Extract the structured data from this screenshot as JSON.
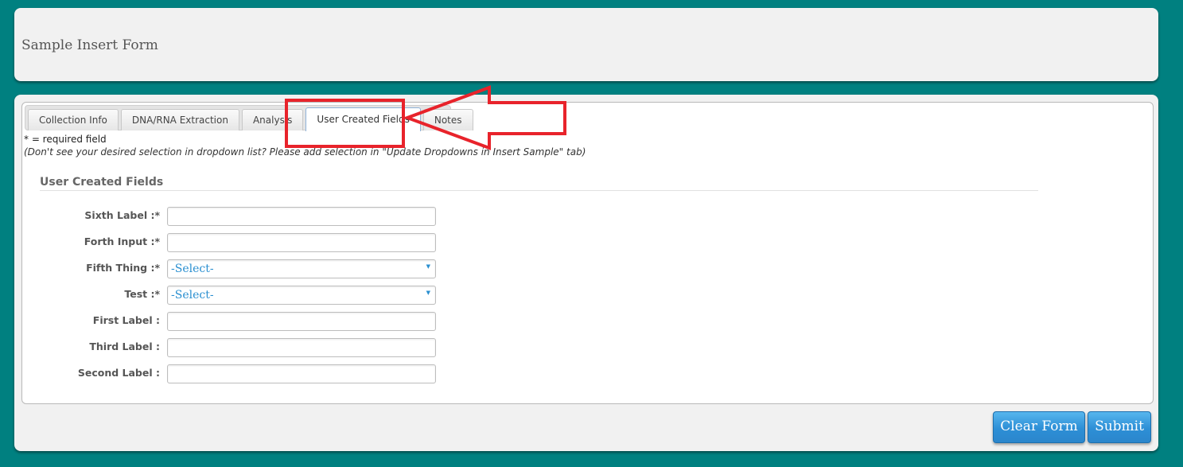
{
  "header": {
    "title": "Sample Insert Form"
  },
  "tabs": [
    {
      "label": "Collection Info",
      "active": false
    },
    {
      "label": "DNA/RNA Extraction",
      "active": false
    },
    {
      "label": "Analysis",
      "active": false
    },
    {
      "label": "User Created Fields",
      "active": true
    },
    {
      "label": "Notes",
      "active": false
    }
  ],
  "notes": {
    "required": "* = required field",
    "dropdown": "(Don't see your desired selection in dropdown list? Please add selection in \"Update Dropdowns in Insert Sample\" tab)"
  },
  "section": {
    "title": "User Created Fields"
  },
  "fields": [
    {
      "label": "Sixth Label :*",
      "type": "text",
      "value": ""
    },
    {
      "label": "Forth Input :*",
      "type": "text",
      "value": ""
    },
    {
      "label": "Fifth Thing :*",
      "type": "select",
      "value": "-Select-"
    },
    {
      "label": "Test :*",
      "type": "select",
      "value": "-Select-"
    },
    {
      "label": "First Label :",
      "type": "text",
      "value": ""
    },
    {
      "label": "Third Label :",
      "type": "text",
      "value": ""
    },
    {
      "label": "Second Label :",
      "type": "text",
      "value": ""
    }
  ],
  "buttons": {
    "clear": "Clear Form",
    "submit": "Submit"
  },
  "colors": {
    "background": "#008080",
    "panel": "#f1f1f1",
    "accent": "#2d8fd6",
    "annotation": "#e8232b"
  }
}
